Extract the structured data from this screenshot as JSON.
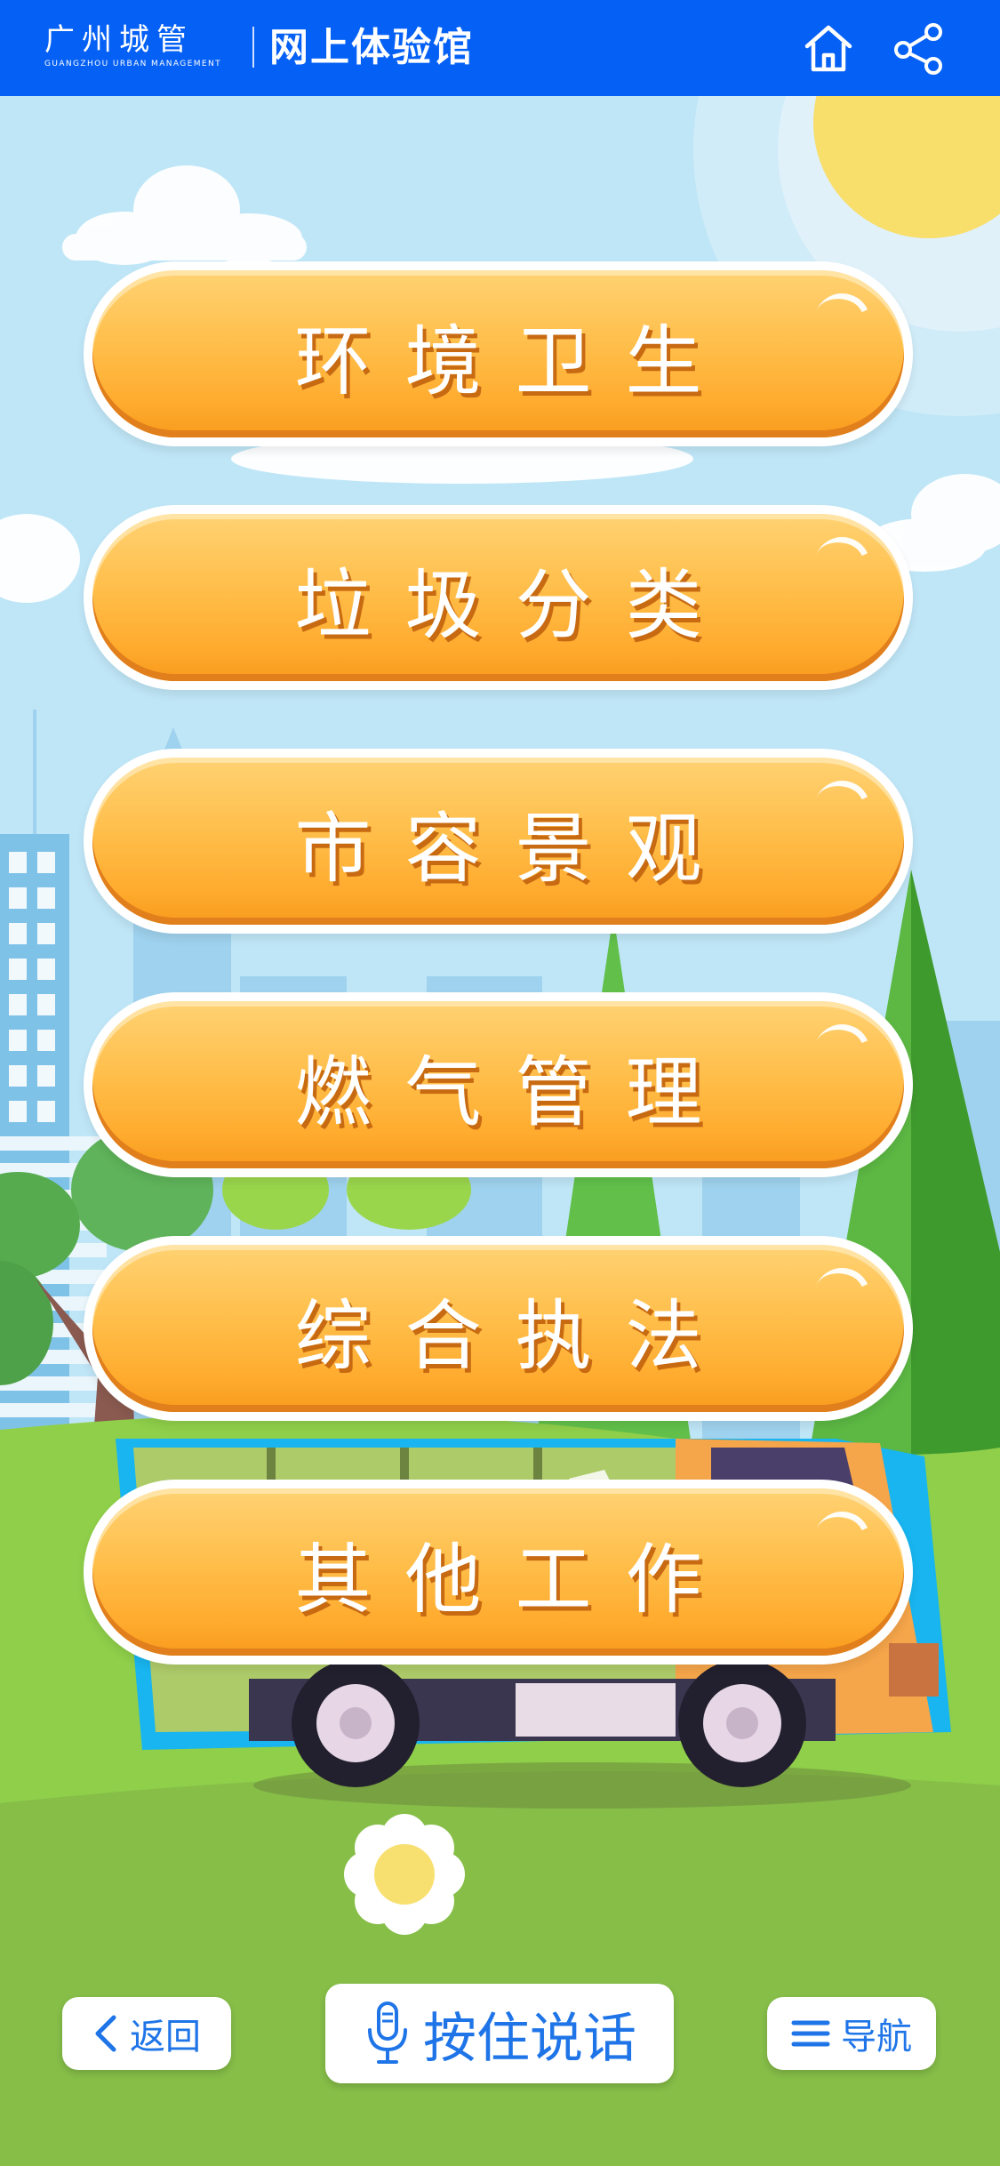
{
  "header": {
    "brand_cn": "广州城管",
    "brand_en": "GUANGZHOU URBAN MANAGEMENT",
    "title": "网上体验馆",
    "home_icon": "home-icon",
    "share_icon": "share-icon"
  },
  "menu": {
    "items": [
      {
        "label": "环境卫生"
      },
      {
        "label": "垃圾分类"
      },
      {
        "label": "市容景观"
      },
      {
        "label": "燃气管理"
      },
      {
        "label": "综合执法"
      },
      {
        "label": "其他工作"
      }
    ]
  },
  "footer": {
    "back_label": "返回",
    "talk_label": "按住说话",
    "nav_label": "导航",
    "back_icon": "chevron-left-icon",
    "mic_icon": "microphone-icon",
    "menu_icon": "hamburger-icon"
  },
  "colors": {
    "header_bg": "#0560f5",
    "button_orange": "#ffb53a",
    "accent_blue": "#1f75e8",
    "grass": "#8cc34a",
    "sky": "#bfe6f7"
  }
}
